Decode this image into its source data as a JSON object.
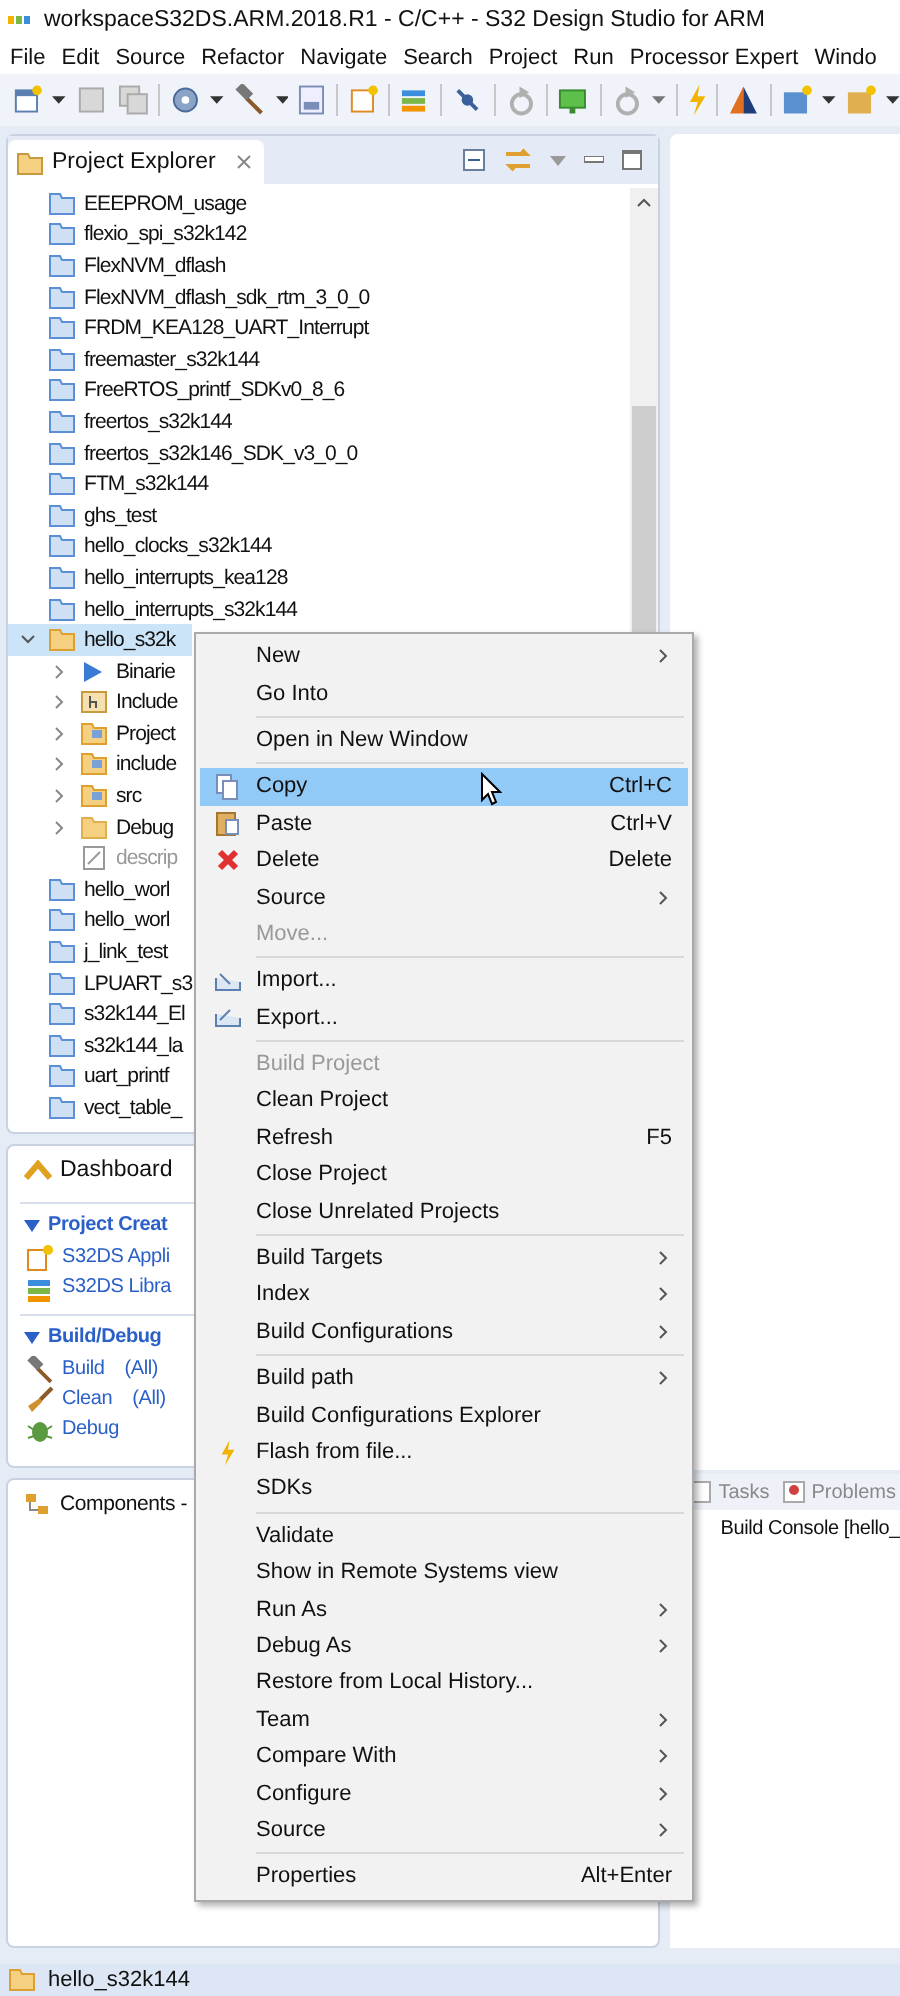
{
  "window": {
    "title": "workspaceS32DS.ARM.2018.R1 - C/C++ - S32 Design Studio for ARM"
  },
  "menu_bar": [
    "File",
    "Edit",
    "Source",
    "Refactor",
    "Navigate",
    "Search",
    "Project",
    "Run",
    "Processor Expert",
    "Windo"
  ],
  "project_explorer": {
    "title": "Project Explorer",
    "items": [
      {
        "label": "EEEPROM_usage",
        "kind": "project",
        "selected": false
      },
      {
        "label": "flexio_spi_s32k142",
        "kind": "project",
        "selected": false
      },
      {
        "label": "FlexNVM_dflash",
        "kind": "project",
        "selected": false
      },
      {
        "label": "FlexNVM_dflash_sdk_rtm_3_0_0",
        "kind": "project",
        "selected": false
      },
      {
        "label": "FRDM_KEA128_UART_Interrupt",
        "kind": "project",
        "selected": false
      },
      {
        "label": "freemaster_s32k144",
        "kind": "project",
        "selected": false
      },
      {
        "label": "FreeRTOS_printf_SDKv0_8_6",
        "kind": "project",
        "selected": false
      },
      {
        "label": "freertos_s32k144",
        "kind": "project",
        "selected": false
      },
      {
        "label": "freertos_s32k146_SDK_v3_0_0",
        "kind": "project",
        "selected": false
      },
      {
        "label": "FTM_s32k144",
        "kind": "project",
        "selected": false
      },
      {
        "label": "ghs_test",
        "kind": "project",
        "selected": false
      },
      {
        "label": "hello_clocks_s32k144",
        "kind": "project",
        "selected": false
      },
      {
        "label": "hello_interrupts_kea128",
        "kind": "project",
        "selected": false
      },
      {
        "label": "hello_interrupts_s32k144",
        "kind": "project",
        "selected": false
      },
      {
        "label": "hello_s32k",
        "kind": "open-project",
        "selected": true,
        "expanded": true,
        "children": [
          {
            "label": "Binarie",
            "kind": "binaries",
            "selected": false,
            "expanded": false
          },
          {
            "label": "Include",
            "kind": "includes",
            "selected": false,
            "expanded": false
          },
          {
            "label": "Project",
            "kind": "source-folder",
            "selected": false,
            "expanded": false
          },
          {
            "label": "include",
            "kind": "source-folder",
            "selected": false,
            "expanded": false
          },
          {
            "label": "src",
            "kind": "source-folder",
            "selected": false,
            "expanded": false
          },
          {
            "label": "Debug",
            "kind": "folder",
            "selected": false,
            "expanded": false
          },
          {
            "label": "descrip",
            "kind": "file",
            "selected": false
          }
        ]
      },
      {
        "label": "hello_worl",
        "kind": "project",
        "selected": false
      },
      {
        "label": "hello_worl",
        "kind": "project",
        "selected": false
      },
      {
        "label": "j_link_test",
        "kind": "project",
        "selected": false
      },
      {
        "label": "LPUART_s3",
        "kind": "project",
        "selected": false
      },
      {
        "label": "s32k144_El",
        "kind": "project",
        "selected": false
      },
      {
        "label": "s32k144_la",
        "kind": "project",
        "selected": false
      },
      {
        "label": "uart_printf",
        "kind": "project",
        "selected": false
      },
      {
        "label": "vect_table_",
        "kind": "project",
        "selected": false
      }
    ]
  },
  "dashboard": {
    "title": "Dashboard",
    "sections": [
      {
        "title": "Project Creat",
        "expanded": true,
        "items": [
          {
            "label": "S32DS Appli"
          },
          {
            "label": "S32DS Libra"
          }
        ]
      },
      {
        "title": "Build/Debug",
        "expanded": true,
        "items": [
          {
            "label": "Build",
            "extra": "(All)"
          },
          {
            "label": "Clean",
            "extra": "(All)"
          },
          {
            "label": "Debug"
          }
        ]
      }
    ]
  },
  "components": {
    "title": "Components -"
  },
  "bottom_tabs": [
    {
      "label": "Tasks"
    },
    {
      "label": "Problems"
    }
  ],
  "console_tab": {
    "label": "Build Console [hello_"
  },
  "context_menu": [
    {
      "kind": "item",
      "label": "New",
      "submenu": true,
      "disabled": false,
      "selected": false
    },
    {
      "kind": "item",
      "label": "Go Into",
      "disabled": false,
      "selected": false
    },
    {
      "kind": "separator"
    },
    {
      "kind": "item",
      "label": "Open in New Window",
      "disabled": false,
      "selected": false
    },
    {
      "kind": "separator"
    },
    {
      "kind": "copy",
      "label": "Copy",
      "shortcut": "Ctrl+C",
      "disabled": false,
      "selected": true
    },
    {
      "kind": "paste",
      "label": "Paste",
      "shortcut": "Ctrl+V",
      "disabled": false,
      "selected": false
    },
    {
      "kind": "delete",
      "label": "Delete",
      "shortcut": "Delete",
      "disabled": false,
      "selected": false
    },
    {
      "kind": "item",
      "label": "Source",
      "submenu": true,
      "disabled": false,
      "selected": false
    },
    {
      "kind": "item",
      "label": "Move...",
      "disabled": true,
      "selected": false
    },
    {
      "kind": "separator"
    },
    {
      "kind": "import",
      "label": "Import...",
      "disabled": false,
      "selected": false
    },
    {
      "kind": "export",
      "label": "Export...",
      "disabled": false,
      "selected": false
    },
    {
      "kind": "separator"
    },
    {
      "kind": "item",
      "label": "Build Project",
      "disabled": true,
      "selected": false
    },
    {
      "kind": "item",
      "label": "Clean Project",
      "disabled": false,
      "selected": false
    },
    {
      "kind": "item",
      "label": "Refresh",
      "shortcut": "F5",
      "disabled": false,
      "selected": false
    },
    {
      "kind": "item",
      "label": "Close Project",
      "disabled": false,
      "selected": false
    },
    {
      "kind": "item",
      "label": "Close Unrelated Projects",
      "disabled": false,
      "selected": false
    },
    {
      "kind": "separator"
    },
    {
      "kind": "item",
      "label": "Build Targets",
      "submenu": true,
      "disabled": false,
      "selected": false
    },
    {
      "kind": "item",
      "label": "Index",
      "submenu": true,
      "disabled": false,
      "selected": false
    },
    {
      "kind": "item",
      "label": "Build Configurations",
      "submenu": true,
      "disabled": false,
      "selected": false
    },
    {
      "kind": "separator"
    },
    {
      "kind": "item",
      "label": "Build path",
      "submenu": true,
      "disabled": false,
      "selected": false
    },
    {
      "kind": "item",
      "label": "Build Configurations Explorer",
      "disabled": false,
      "selected": false
    },
    {
      "kind": "flash",
      "label": "Flash from file...",
      "disabled": false,
      "selected": false
    },
    {
      "kind": "item",
      "label": "SDKs",
      "disabled": false,
      "selected": false
    },
    {
      "kind": "separator"
    },
    {
      "kind": "item",
      "label": "Validate",
      "disabled": false,
      "selected": false
    },
    {
      "kind": "item",
      "label": "Show in Remote Systems view",
      "disabled": false,
      "selected": false
    },
    {
      "kind": "item",
      "label": "Run As",
      "submenu": true,
      "disabled": false,
      "selected": false
    },
    {
      "kind": "item",
      "label": "Debug As",
      "submenu": true,
      "disabled": false,
      "selected": false
    },
    {
      "kind": "item",
      "label": "Restore from Local History...",
      "disabled": false,
      "selected": false
    },
    {
      "kind": "item",
      "label": "Team",
      "submenu": true,
      "disabled": false,
      "selected": false
    },
    {
      "kind": "item",
      "label": "Compare With",
      "submenu": true,
      "disabled": false,
      "selected": false
    },
    {
      "kind": "item",
      "label": "Configure",
      "submenu": true,
      "disabled": false,
      "selected": false
    },
    {
      "kind": "item",
      "label": "Source",
      "submenu": true,
      "disabled": false,
      "selected": false
    },
    {
      "kind": "separator"
    },
    {
      "kind": "item",
      "label": "Properties",
      "shortcut": "Alt+Enter",
      "disabled": false,
      "selected": false
    }
  ],
  "status_bar": {
    "text": "hello_s32k144"
  }
}
